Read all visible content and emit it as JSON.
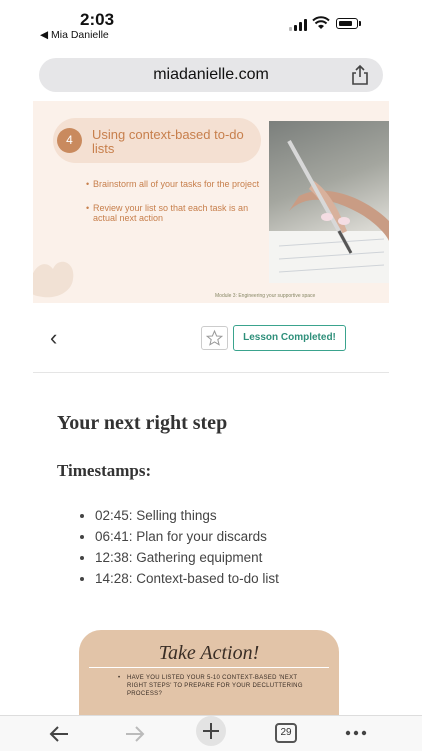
{
  "status": {
    "time": "2:03",
    "back_app": "◀ Mia Danielle"
  },
  "browser": {
    "url": "miadanielle.com",
    "tab_count": "29"
  },
  "slide": {
    "step_number": "4",
    "title": "Using context-based to-do lists",
    "bullets": [
      "Brainstorm all of your tasks for the project",
      "Review your list so that each task is an actual next action"
    ],
    "footer": "Module 3: Engineering your supportive space"
  },
  "lesson": {
    "back_icon": "‹",
    "completed_label": "Lesson Completed!"
  },
  "content": {
    "heading": "Your next right step",
    "timestamps_heading": "Timestamps:",
    "timestamps": [
      "02:45: Selling things",
      "06:41: Plan for your discards",
      "12:38: Gathering equipment",
      "14:28: Context-based to-do list"
    ]
  },
  "take_action": {
    "title": "Take Action!",
    "text": "Have you listed your 5-10 context-based 'next right steps' to prepare for your decluttering process?"
  },
  "colors": {
    "accent": "#3aa38d",
    "slide_bg": "#fbf1ea",
    "slide_text": "#c77f4c",
    "card_bg": "#e2c4a8"
  }
}
